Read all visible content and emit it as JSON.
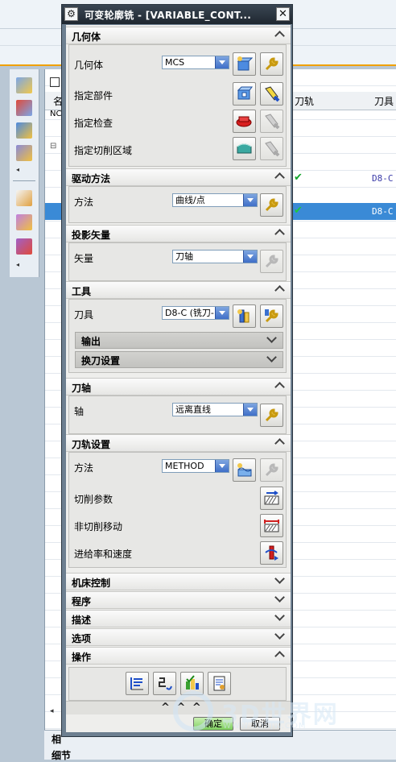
{
  "background": {
    "nav_columns": {
      "name": "名",
      "toolpath": "刀轨",
      "tool": "刀具"
    },
    "nav_first_row": "NC_",
    "nav_rows": [
      {
        "tool": "D8-C",
        "selected": false
      },
      {
        "tool": "D8-C",
        "selected": true
      }
    ],
    "bottom_panel": {
      "related": "相",
      "details": "细节"
    },
    "watermark": {
      "text": "3D世界网",
      "url": "WWW.3DSJW.COM"
    }
  },
  "dialog": {
    "title": "可变轮廓铣 - [VARIABLE_CONT...",
    "sections": {
      "geometry": {
        "header": "几何体",
        "geometry_label": "几何体",
        "geometry_value": "MCS",
        "part_label": "指定部件",
        "check_label": "指定检查",
        "cut_area_label": "指定切削区域"
      },
      "drive_method": {
        "header": "驱动方法",
        "method_label": "方法",
        "method_value": "曲线/点"
      },
      "projection": {
        "header": "投影矢量",
        "vector_label": "矢量",
        "vector_value": "刀轴"
      },
      "tool": {
        "header": "工具",
        "tool_label": "刀具",
        "tool_value": "D8-C (铣刀-",
        "output": "输出",
        "tool_change": "换刀设置"
      },
      "tool_axis": {
        "header": "刀轴",
        "axis_label": "轴",
        "axis_value": "远离直线"
      },
      "path_settings": {
        "header": "刀轨设置",
        "method_label": "方法",
        "method_value": "METHOD",
        "cut_params": "切削参数",
        "non_cut_moves": "非切削移动",
        "feeds_speeds": "进给率和速度"
      },
      "machine_control": {
        "header": "机床控制"
      },
      "program": {
        "header": "程序"
      },
      "description": {
        "header": "描述"
      },
      "options": {
        "header": "选项"
      },
      "actions": {
        "header": "操作"
      }
    },
    "collapse_glyph": "^ ^ ^",
    "ok_label": "确定",
    "cancel_label": "取消"
  },
  "colors": {
    "ok_button": "#7fcf5f",
    "selection": "#3a8ad6",
    "title_bar": "#1f2730"
  }
}
